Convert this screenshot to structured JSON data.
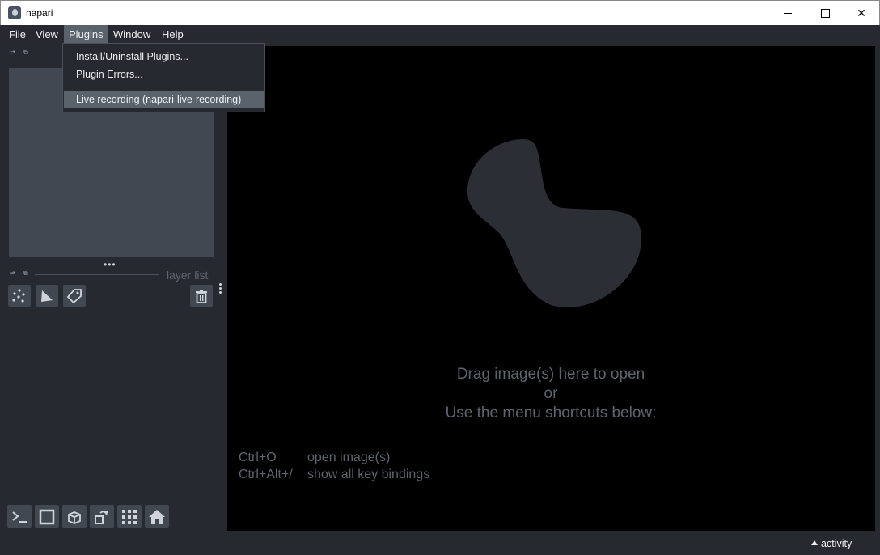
{
  "window": {
    "title": "napari"
  },
  "menubar": {
    "items": [
      "File",
      "View",
      "Plugins",
      "Window",
      "Help"
    ],
    "active": "Plugins"
  },
  "plugins_menu": {
    "items": [
      "Install/Uninstall Plugins...",
      "Plugin Errors...",
      "Live recording (napari-live-recording)"
    ],
    "highlighted": "Live recording (napari-live-recording)"
  },
  "layer_list": {
    "label": "layer list"
  },
  "layer_tools": [
    {
      "name": "new-points-layer-icon"
    },
    {
      "name": "new-shapes-layer-icon"
    },
    {
      "name": "new-labels-layer-icon"
    },
    {
      "name": "delete-layer-icon"
    }
  ],
  "viewer_buttons": [
    {
      "name": "console-icon"
    },
    {
      "name": "ndisplay-2d-icon"
    },
    {
      "name": "roll-dims-icon"
    },
    {
      "name": "transpose-icon"
    },
    {
      "name": "grid-view-icon"
    },
    {
      "name": "home-icon"
    }
  ],
  "canvas": {
    "welcome": {
      "line1": "Drag image(s) here to open",
      "line2": "or",
      "line3": "Use the menu shortcuts below:"
    },
    "shortcuts": [
      {
        "key": "Ctrl+O",
        "desc": "open image(s)"
      },
      {
        "key": "Ctrl+Alt+/",
        "desc": "show all key bindings"
      }
    ]
  },
  "statusbar": {
    "activity": "activity"
  },
  "colors": {
    "background": "#262930",
    "panel": "#414851",
    "canvas": "#000000",
    "menu_highlight": "#5a626c",
    "muted_text": "#5e646e",
    "logo_fill": "#2b2e35"
  }
}
